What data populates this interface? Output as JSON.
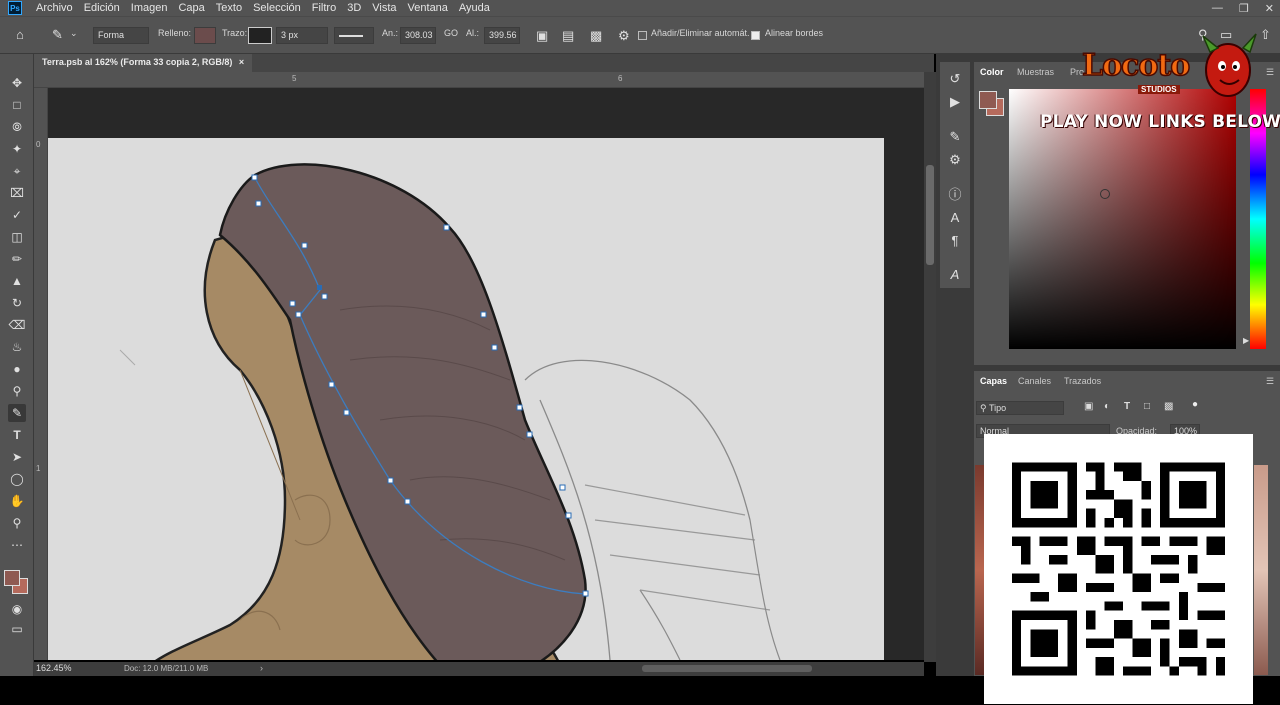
{
  "menubar": {
    "app_icon": "Ps",
    "items": [
      "Archivo",
      "Edición",
      "Imagen",
      "Capa",
      "Texto",
      "Selección",
      "Filtro",
      "3D",
      "Vista",
      "Ventana",
      "Ayuda"
    ]
  },
  "options": {
    "mode": "Forma",
    "fill_label": "Relleno:",
    "stroke_label": "Trazo:",
    "stroke_width": "3 px",
    "width_label": "An.:",
    "width_value": "308.03",
    "link_symbol": "GO",
    "height_label": "Al.:",
    "height_value": "399.56",
    "auto_add_label": "Añadir/Eliminar automát.",
    "align_edges_label": "Alinear bordes",
    "fill_color": "#6b4c4c"
  },
  "document": {
    "tab_title": "Terra.psb al 162% (Forma 33 copia 2, RGB/8)",
    "tab_close": "×",
    "ruler_top": [
      "5",
      "6"
    ],
    "ruler_left": [
      "0",
      "1"
    ],
    "zoom": "162.45%",
    "doc_info": "Doc: 12.0 MB/211.0 MB"
  },
  "panels": {
    "color_tabs": [
      "Color",
      "Muestras",
      "Pro"
    ],
    "layers_tabs": [
      "Capas",
      "Canales",
      "Trazados"
    ],
    "filter_kind": "Tipo",
    "blend_mode": "Normal",
    "opacity_label": "Opacidad:",
    "opacity_value": "100%",
    "fg_color": "#8f5a52",
    "bg_color": "#b56a5c"
  },
  "overlay": {
    "logo_text": "Locoto",
    "logo_sub": "STUDIOS",
    "promo": "PLAY NOW LINKS BELOW"
  },
  "tools": [
    "move-icon",
    "marquee-icon",
    "lasso-icon",
    "magic-wand-icon",
    "crop-icon",
    "frame-icon",
    "eyedropper-icon",
    "healing-icon",
    "brush-icon",
    "stamp-icon",
    "history-brush-icon",
    "eraser-icon",
    "paint-bucket-icon",
    "blur-icon",
    "dodge-icon",
    "pen-icon",
    "type-icon",
    "path-select-icon",
    "ellipse-icon",
    "hand-icon",
    "zoom-icon",
    "more-icon"
  ]
}
